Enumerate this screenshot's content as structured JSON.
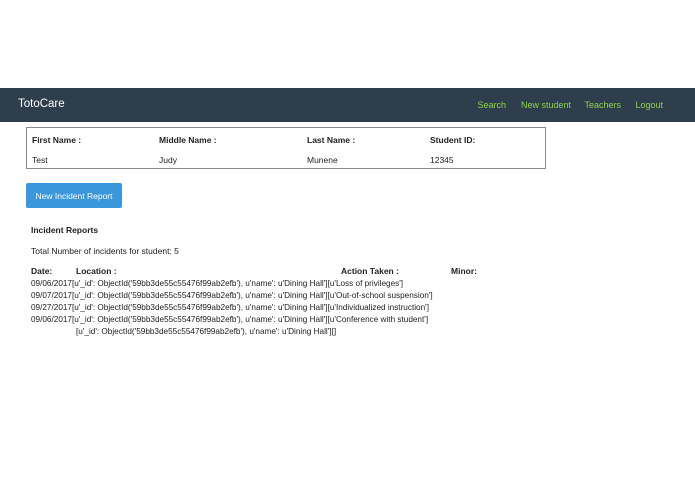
{
  "navbar": {
    "brand": "TotoCare",
    "links": [
      "Search",
      "New student",
      "Teachers",
      "Logout"
    ]
  },
  "student": {
    "headers": {
      "first_name": "First Name :",
      "middle_name": "Middle Name :",
      "last_name": "Last Name :",
      "student_id": "Student ID:"
    },
    "values": {
      "first_name": "Test",
      "middle_name": "Judy",
      "last_name": "Munene",
      "student_id": "12345"
    }
  },
  "new_incident_button": "New Incident Report",
  "incidents": {
    "title": "Incident Reports",
    "total_text": "Total Number of incidents for student: 5",
    "columns": {
      "date": "Date:",
      "location": "Location :",
      "action": "Action Taken :",
      "minor": "Minor:"
    },
    "rows": [
      {
        "date": "09/06/2017",
        "location": "[u'_id': ObjectId('59bb3de55c55476f99ab2efb'), u'name': u'Dining Hall']",
        "action": "[u'Loss of privileges']"
      },
      {
        "date": "09/07/2017",
        "location": "[u'_id': ObjectId('59bb3de55c55476f99ab2efb'), u'name': u'Dining Hall']",
        "action": "[u'Out-of-school suspension']"
      },
      {
        "date": "09/27/2017",
        "location": "[u'_id': ObjectId('59bb3de55c55476f99ab2efb'), u'name': u'Dining Hall']",
        "action": "[u'Individualized instruction']"
      },
      {
        "date": "09/06/2017",
        "location": "[u'_id': ObjectId('59bb3de55c55476f99ab2efb'), u'name': u'Dining Hall']",
        "action": "[u'Conference with student']"
      },
      {
        "date": "",
        "location": "[u'_id': ObjectId('59bb3de55c55476f99ab2efb'), u'name': u'Dining Hall']",
        "action": "[]"
      }
    ]
  }
}
